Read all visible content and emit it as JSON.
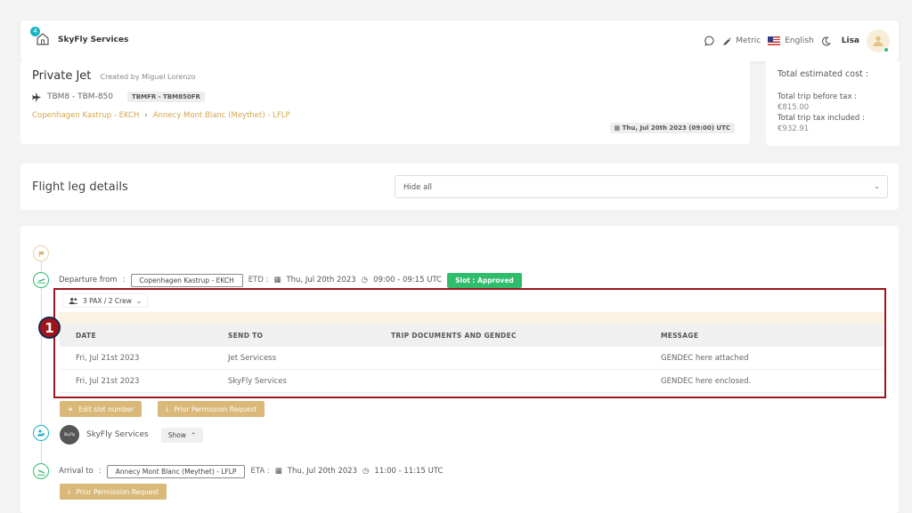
{
  "nav": {
    "brand": "SkyFly Services",
    "notification_count": "4",
    "units_label": "Metric",
    "language_label": "English",
    "user_name": "Lisa"
  },
  "trip": {
    "title": "Private Jet",
    "creator": "Created by Miguel Lorenzo",
    "aircraft": "TBM8 - TBM-850",
    "registration": "TBMFR - TBM850FR",
    "origin": "Copenhagen Kastrup - EKCH",
    "destination": "Annecy Mont Blanc (Meythet) - LFLP",
    "date": "Thu, Jul 20th 2023 (09:00) UTC"
  },
  "cost": {
    "total_label": "Total estimated cost :",
    "before_tax_label": "Total trip before tax :",
    "before_tax_value": "€815.00",
    "tax_included_label": "Total trip tax included :",
    "tax_included_value": "€932.91"
  },
  "leg_details": {
    "title": "Flight leg details",
    "select_value": "Hide all"
  },
  "departure": {
    "label": "Departure from",
    "colon": ":",
    "airport": "Copenhagen Kastrup - EKCH",
    "etd_label": "ETD :",
    "date": "Thu, Jul 20th 2023",
    "time": "09:00 - 09:15 UTC",
    "slot": "Slot : Approved"
  },
  "pax": {
    "label": "3 PAX / 2 Crew"
  },
  "step_number": "1",
  "docs_table": {
    "columns": [
      "DATE",
      "SEND TO",
      "TRIP DOCUMENTS AND GENDEC",
      "MESSAGE"
    ],
    "rows": [
      {
        "date": "Fri, Jul 21st 2023",
        "send_to": "Jet Servicess",
        "docs": "",
        "message": "GENDEC here attached"
      },
      {
        "date": "Fri, Jul 21st 2023",
        "send_to": "SkyFly Services",
        "docs": "",
        "message": "GENDEC here enclosed."
      }
    ]
  },
  "actions": {
    "edit_slot": "Edit slot number",
    "prior_permission": "Prior Permission Request"
  },
  "crew": {
    "operator_logo_text": "SkyFly",
    "operator": "SkyFly Services",
    "show_label": "Show"
  },
  "arrival": {
    "label": "Arrival to",
    "colon": ":",
    "airport": "Annecy Mont Blanc (Meythet) - LFLP",
    "eta_label": "ETA :",
    "date": "Thu, Jul 20th 2023",
    "time": "11:00 - 11:15 UTC"
  }
}
